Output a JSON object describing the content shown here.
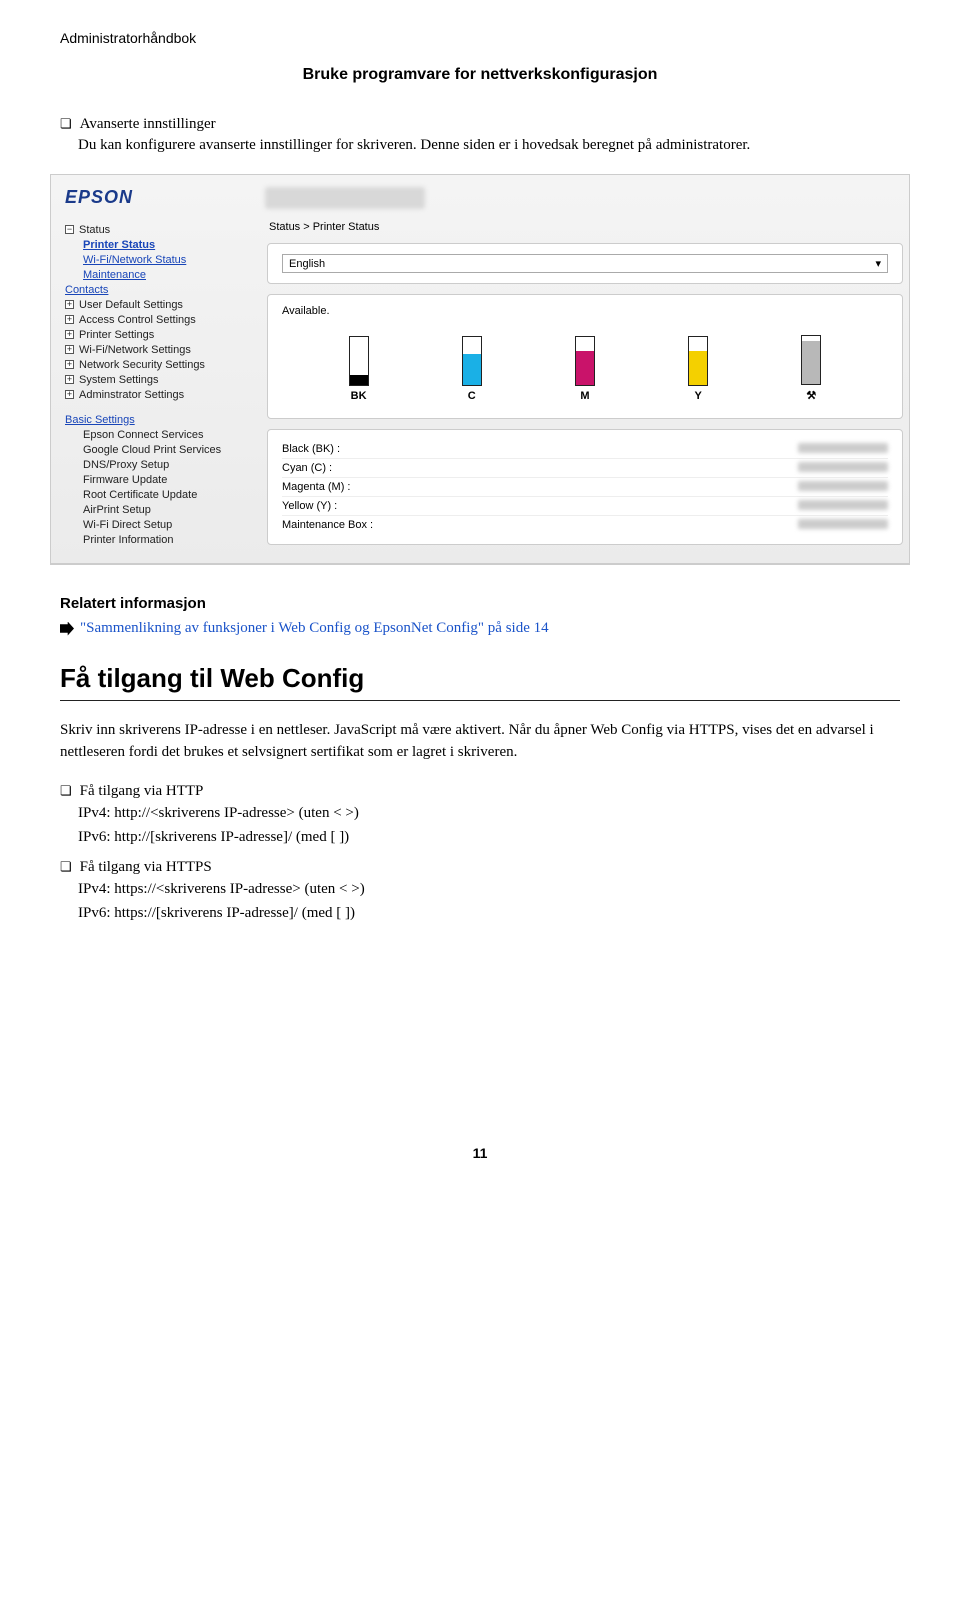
{
  "doc": {
    "header": "Administratorhåndbok",
    "section_title": "Bruke programvare for nettverkskonfigurasjon",
    "bullet1_title": "Avanserte innstillinger",
    "bullet1_body": "Du kan konfigurere avanserte innstillinger for skriveren. Denne siden er i hovedsak beregnet på administratorer."
  },
  "shot": {
    "brand": "EPSON",
    "breadcrumb": "Status > Printer Status",
    "tree": {
      "status": "Status",
      "printer_status": "Printer Status",
      "wifi_status": "Wi-Fi/Network Status",
      "maintenance": "Maintenance",
      "contacts": "Contacts",
      "user_default": "User Default Settings",
      "access_control": "Access Control Settings",
      "printer_settings": "Printer Settings",
      "wifi_settings": "Wi-Fi/Network Settings",
      "net_security": "Network Security Settings",
      "system_settings": "System Settings",
      "admin_settings": "Adminstrator Settings",
      "basic": "Basic Settings",
      "epson_connect": "Epson Connect Services",
      "gcp": "Google Cloud Print Services",
      "dns": "DNS/Proxy Setup",
      "firmware": "Firmware Update",
      "root_cert": "Root Certificate Update",
      "airprint": "AirPrint Setup",
      "wifi_direct": "Wi-Fi Direct Setup",
      "printer_info": "Printer Information"
    },
    "language": "English",
    "available": "Available.",
    "inks": {
      "bk": "BK",
      "c": "C",
      "m": "M",
      "y": "Y",
      "mb": "⚒"
    },
    "consumables": {
      "black": "Black (BK) :",
      "cyan": "Cyan (C) :",
      "magenta": "Magenta (M) :",
      "yellow": "Yellow (Y) :",
      "maint_box": "Maintenance Box :"
    }
  },
  "related": {
    "heading": "Relatert informasjon",
    "link": "\"Sammenlikning av funksjoner i Web Config og EpsonNet Config\" på side 14"
  },
  "h2": "Få tilgang til Web Config",
  "para2": "Skriv inn skriverens IP-adresse i en nettleser. JavaScript må være aktivert. Når du åpner Web Config via HTTPS, vises det en advarsel i nettleseren fordi det brukes et selvsignert sertifikat som er lagret i skriveren.",
  "http": {
    "title": "Få tilgang via HTTP",
    "ipv4": "IPv4: http://<skriverens IP-adresse> (uten < >)",
    "ipv6": "IPv6: http://[skriverens IP-adresse]/ (med [ ])"
  },
  "https": {
    "title": "Få tilgang via HTTPS",
    "ipv4": "IPv4: https://<skriverens IP-adresse> (uten < >)",
    "ipv6": "IPv6: https://[skriverens IP-adresse]/ (med [ ])"
  },
  "page_number": "11"
}
